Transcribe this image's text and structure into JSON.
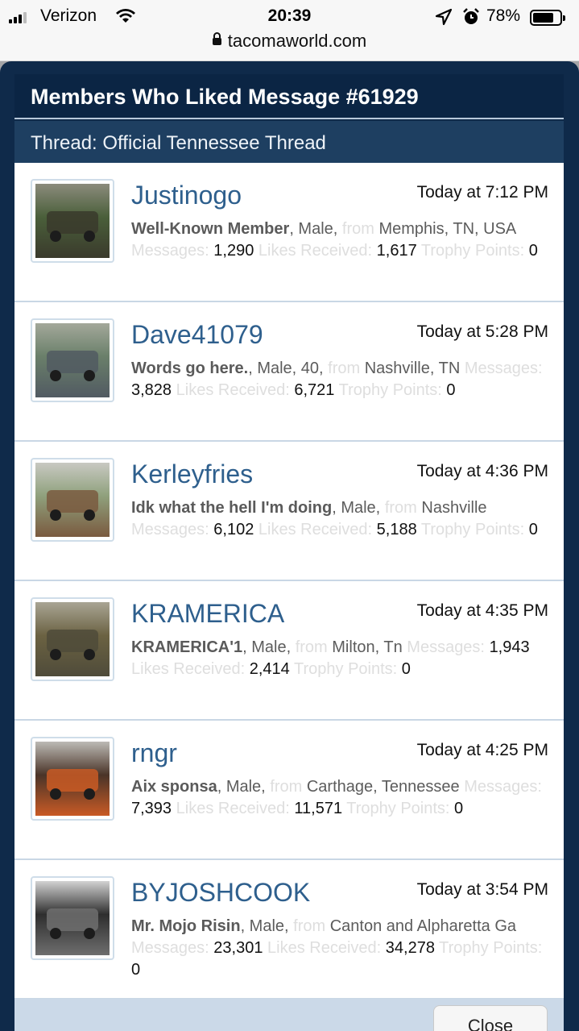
{
  "status": {
    "carrier": "Verizon",
    "time": "20:39",
    "battery": "78%",
    "battery_level": 0.78,
    "url": "tacomaworld.com"
  },
  "overlay": {
    "title": "Members Who Liked Message #61929",
    "subtitle": "Thread: Official Tennessee Thread",
    "close_label": "Close"
  },
  "labels": {
    "from": "from",
    "messages": "Messages:",
    "likes": "Likes Received:",
    "trophy": "Trophy Points:"
  },
  "members": [
    {
      "name": "Justinogo",
      "time": "Today at 7:12 PM",
      "title": "Well-Known Member",
      "meta": ", Male,",
      "location": "Memphis, TN, USA",
      "messages": "1,290",
      "likes": "1,617",
      "trophy": "0",
      "avatar_colors": [
        "#4a5f3a",
        "#3a3a2c",
        "#8b8b7c"
      ]
    },
    {
      "name": "Dave41079",
      "time": "Today at 5:28 PM",
      "title": "Words go here.",
      "meta": ", Male, 40,",
      "location": "Nashville, TN",
      "messages": "3,828",
      "likes": "6,721",
      "trophy": "0",
      "avatar_colors": [
        "#6a7f6a",
        "#515a62",
        "#a3a89a"
      ]
    },
    {
      "name": "Kerleyfries",
      "time": "Today at 4:36 PM",
      "title": "Idk what the hell I'm doing",
      "meta": ", Male,",
      "location": "Nashville",
      "messages": "6,102",
      "likes": "5,188",
      "trophy": "0",
      "avatar_colors": [
        "#8fa07c",
        "#7a5a3f",
        "#c8c9c2"
      ]
    },
    {
      "name": "KRAMERICA",
      "time": "Today at 4:35 PM",
      "title": "KRAMERICA'1",
      "meta": ", Male,",
      "location": "Milton, Tn",
      "messages": "1,943",
      "likes": "2,414",
      "trophy": "0",
      "avatar_colors": [
        "#6b6242",
        "#4f4b3a",
        "#a9a594"
      ]
    },
    {
      "name": "rngr",
      "time": "Today at 4:25 PM",
      "title": "Aix sponsa",
      "meta": ", Male,",
      "location": "Carthage, Tennessee",
      "messages": "7,393",
      "likes": "11,571",
      "trophy": "0",
      "avatar_colors": [
        "#4a3428",
        "#c95a25",
        "#bcbab5"
      ]
    },
    {
      "name": "BYJOSHCOOK",
      "time": "Today at 3:54 PM",
      "title": "Mr. Mojo Risin",
      "meta": ", Male,",
      "location": "Canton and Alpharetta Ga",
      "messages": "23,301",
      "likes": "34,278",
      "trophy": "0",
      "avatar_colors": [
        "#2e2e2e",
        "#6e6e6e",
        "#d2d2d2"
      ]
    }
  ]
}
